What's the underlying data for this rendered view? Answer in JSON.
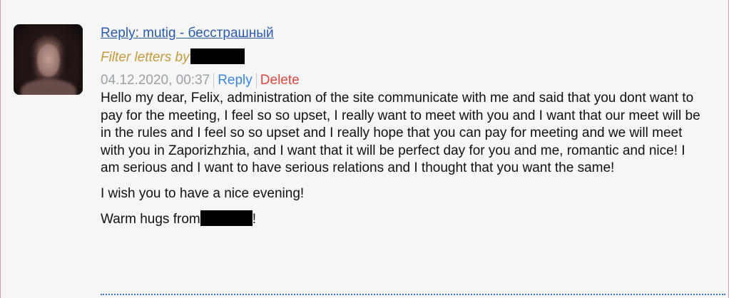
{
  "message": {
    "subject_link": "Reply: mutig - бесстрашный",
    "filter_label": "Filter letters by",
    "date": "04.12.2020, 00:37",
    "reply_label": "Reply",
    "delete_label": "Delete",
    "paragraph_1": "Hello my dear, Felix, administration of the site communicate with me and said that you dont want to pay for the meeting, I feel so so upset, I really want to meet with you and I want that our meet will be in the rules and I feel so so upset and I really hope that you can pay for meeting and we will meet with you in Zaporizhzhia, and I want that it will be perfect day for you and me, romantic and nice! I am serious and I want to have serious relations and I thought that you want the same!",
    "paragraph_2": "I wish you to have a nice evening!",
    "paragraph_3_prefix": "Warm hugs from",
    "paragraph_3_suffix": "!"
  },
  "colors": {
    "subject_link": "#2b5bad",
    "filter_label": "#c49a3c",
    "date": "#9aa0a6",
    "reply": "#3b86d9",
    "delete": "#e0473e",
    "separator_dotted": "#3a72c6",
    "card_border": "#d99ab0"
  },
  "icons": {
    "avatar": "user-avatar-photo"
  }
}
